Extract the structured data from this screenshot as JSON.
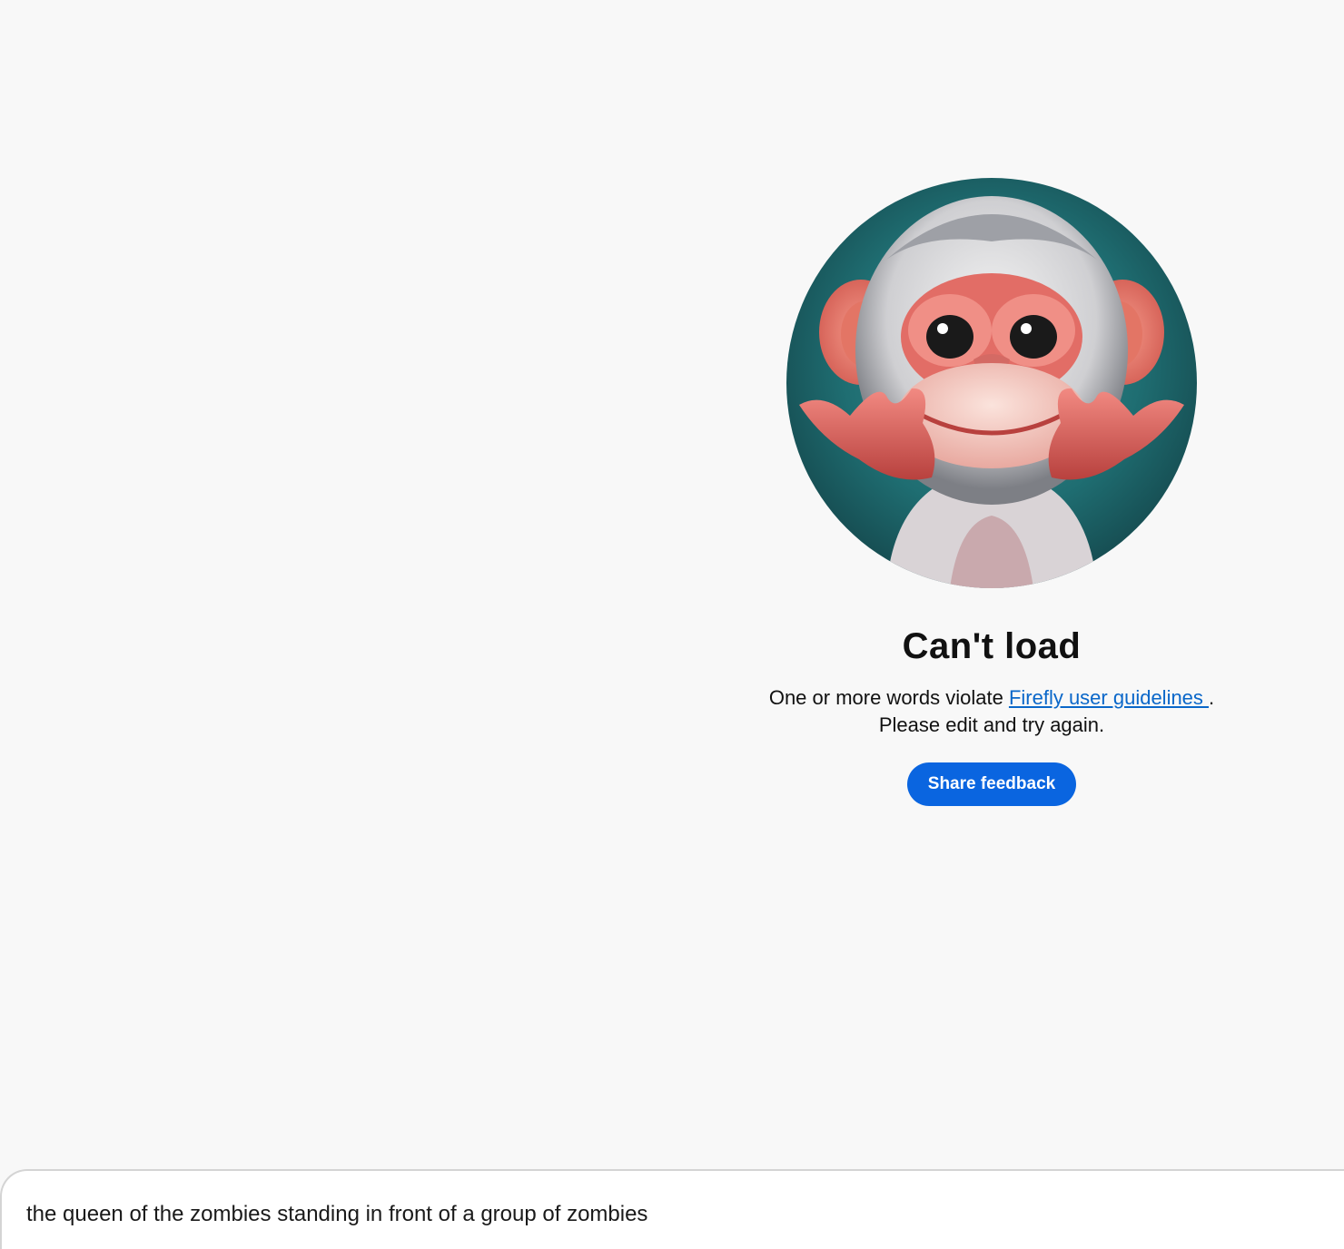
{
  "error": {
    "title": "Can't load",
    "message_prefix": "One or more words violate ",
    "link_text": "Firefly user guidelines ",
    "message_suffix": ".",
    "message_line2": "Please edit and try again.",
    "button_label": "Share feedback",
    "illustration_icon": "monkey-illustration"
  },
  "prompt": {
    "value": "the queen of the zombies standing in front of a group of zombies"
  },
  "colors": {
    "background": "#f8f8f8",
    "accent": "#0a65e0",
    "link": "#0a67c9"
  }
}
